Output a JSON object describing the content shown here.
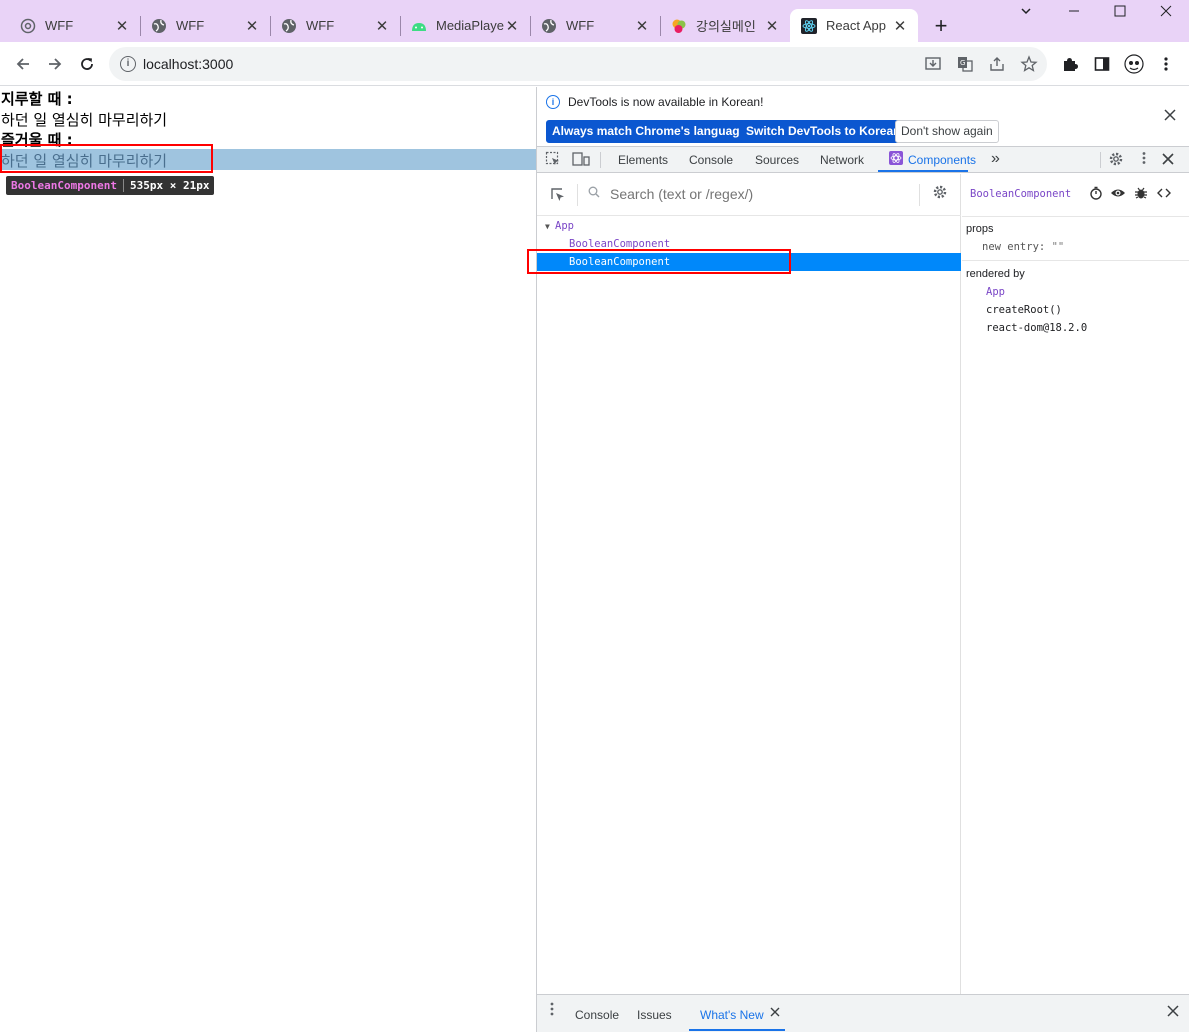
{
  "browser": {
    "tabs": [
      {
        "title": "WFF",
        "icon": "settings-globe-icon"
      },
      {
        "title": "WFF",
        "icon": "globe-icon"
      },
      {
        "title": "WFF",
        "icon": "globe-icon"
      },
      {
        "title": "MediaPlaye",
        "icon": "android-icon"
      },
      {
        "title": "WFF",
        "icon": "globe-icon"
      },
      {
        "title": "강의실메인",
        "icon": "leaf-logo-icon"
      },
      {
        "title": "React App",
        "icon": "react-icon"
      }
    ],
    "active_tab_index": 6,
    "new_tab_label": "+",
    "close_glyph": "✕",
    "url": "localhost:3000"
  },
  "page": {
    "line1": "지루할 때 :",
    "line2": "하던 일 열심히 마무리하기",
    "line3": "즐거울 때 :",
    "line4": "하던 일 열심히 마무리하기",
    "inspect_tooltip": {
      "component": "BooleanComponent",
      "size": "535px × 21px"
    }
  },
  "devtools": {
    "infobar": {
      "message": "DevTools is now available in Korean!",
      "btn_match": "Always match Chrome's language",
      "btn_switch": "Switch DevTools to Korean",
      "btn_dismiss": "Don't show again"
    },
    "tabs": [
      "Elements",
      "Console",
      "Sources",
      "Network",
      "Components"
    ],
    "active_tab": "Components",
    "more_tabs_glyph": "»",
    "search_placeholder": "Search (text or /regex/)",
    "tree": [
      {
        "label": "App",
        "depth": 0,
        "expanded": true
      },
      {
        "label": "BooleanComponent",
        "depth": 1
      },
      {
        "label": "BooleanComponent",
        "depth": 1,
        "selected": true
      }
    ],
    "selected_component": "BooleanComponent",
    "props": {
      "heading": "props",
      "key": "new entry",
      "value": "\"\""
    },
    "rendered_by": {
      "heading": "rendered by",
      "items": [
        "App",
        "createRoot()",
        "react-dom@18.2.0"
      ]
    },
    "drawer": {
      "tabs": [
        "Console",
        "Issues",
        "What's New"
      ],
      "active_tab": "What's New"
    }
  },
  "colors": {
    "tabstrip_bg": "#e9d3f7",
    "highlight": "#9fc4df",
    "selection": "#0088fa",
    "accent": "#1a73e8",
    "red_annotation": "#ff0000"
  }
}
